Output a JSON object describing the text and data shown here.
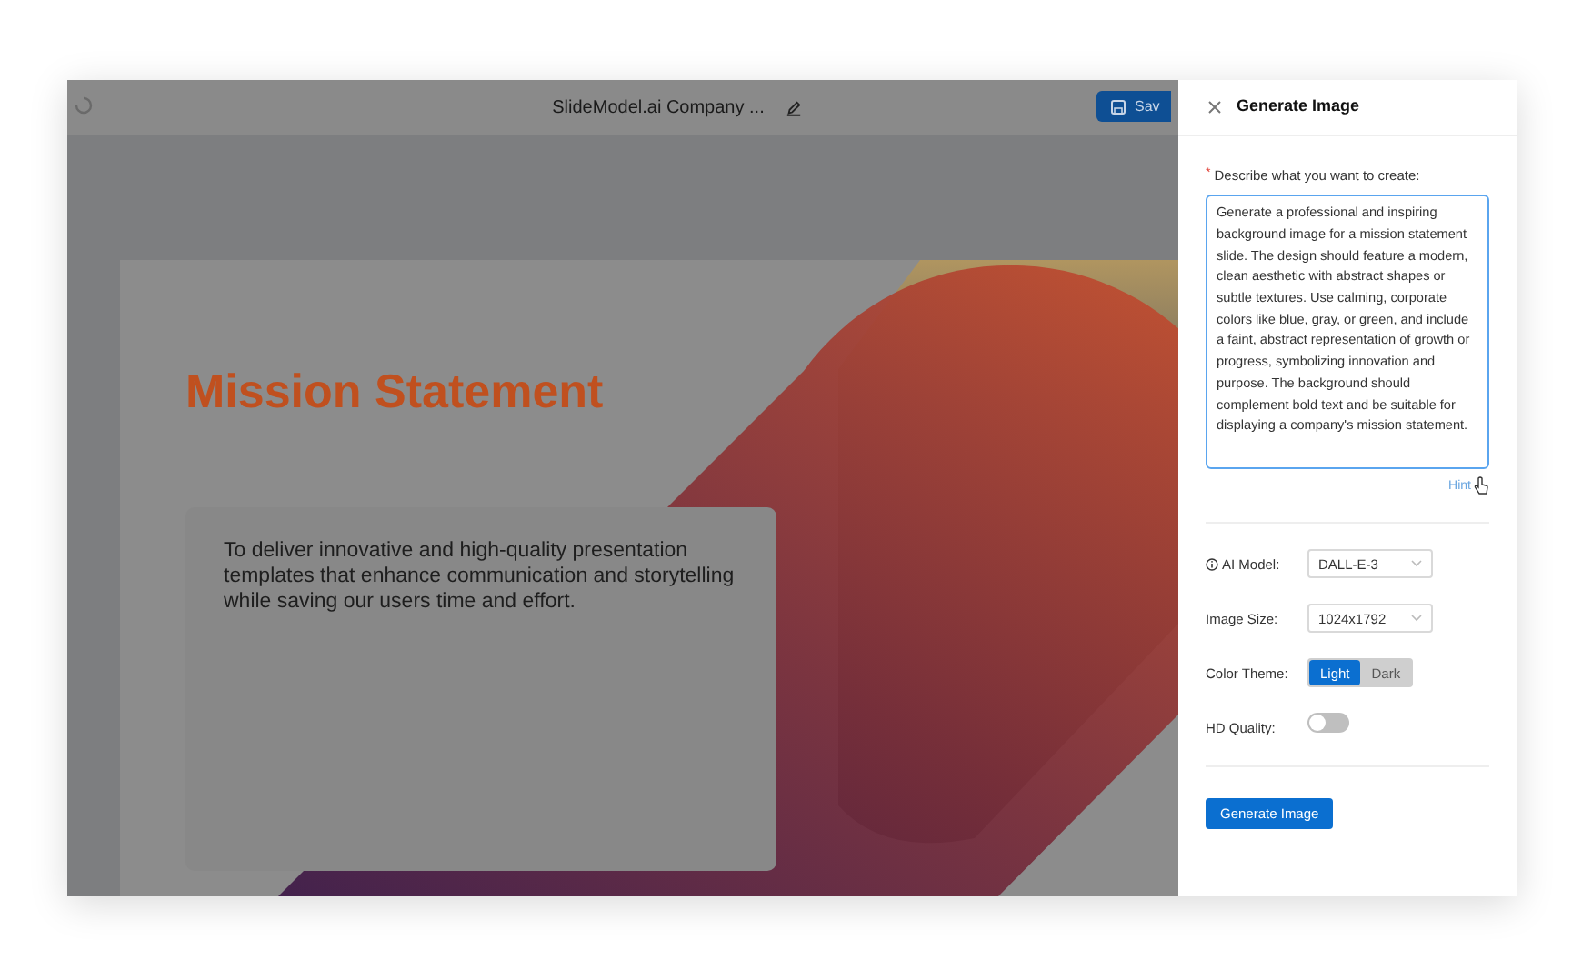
{
  "editor": {
    "title": "SlideModel.ai Company ...",
    "save_button": "Sav"
  },
  "slide": {
    "title": "Mission Statement",
    "body": "To deliver innovative and high-quality presentation templates that enhance communication and storytelling while saving our users time and effort."
  },
  "panel": {
    "title": "Generate Image",
    "prompt_label": "Describe what you want to create:",
    "required": true,
    "required_mark": "*",
    "prompt": "Generate a professional and inspiring background image for a mission statement slide. The design should feature a modern, clean aesthetic with abstract shapes or subtle textures. Use calming, corporate colors like blue, gray, or green, and include a faint, abstract representation of growth or progress, symbolizing innovation and purpose. The background should complement bold text and be suitable for displaying a company's mission statement.",
    "hint": "Hint",
    "fields": [
      {
        "kind": "select",
        "label": "AI Model:",
        "info": true,
        "value": "DALL-E-3"
      },
      {
        "kind": "select",
        "label": "Image Size:",
        "info": false,
        "value": "1024x1792"
      },
      {
        "kind": "segmented",
        "label": "Color Theme:",
        "info": false,
        "options": [
          {
            "label": "Light",
            "selected": true
          },
          {
            "label": "Dark",
            "selected": false
          }
        ]
      },
      {
        "kind": "toggle",
        "label": "HD Quality:",
        "info": false,
        "on": false
      }
    ],
    "submit": "Generate Image"
  }
}
